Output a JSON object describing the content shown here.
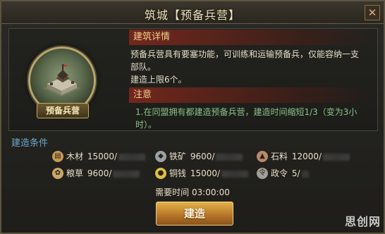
{
  "window": {
    "title": "筑城【预备兵营】",
    "close_label": "✕"
  },
  "building": {
    "name": "预备兵营"
  },
  "details": {
    "heading": "建筑详情",
    "line1": "预备兵营具有要塞功能，可训练和运输预备兵，仅能容纳一支",
    "line2": "部队。",
    "line3": "建造上限6个。"
  },
  "notes": {
    "heading": "注意",
    "line1": "1.在同盟拥有都建造预备兵营，建造时间缩短1/3（变为3小",
    "line2": "时）。"
  },
  "conditions": {
    "title": "建造条件",
    "resources": [
      {
        "icon": "wood-icon",
        "name": "木材",
        "value": "15000/",
        "color": "#c79a55"
      },
      {
        "icon": "iron-icon",
        "name": "铁矿",
        "value": "9600/",
        "color": "#9aa0a6"
      },
      {
        "icon": "stone-icon",
        "name": "石料",
        "value": "12000/",
        "color": "#b88a6a"
      },
      {
        "icon": "grain-icon",
        "name": "粮草",
        "value": "9600/",
        "color": "#c9a86a"
      },
      {
        "icon": "coin-icon",
        "name": "铜钱",
        "value": "15000/",
        "color": "#e0c040"
      },
      {
        "icon": "order-icon",
        "name": "政令",
        "value": "5/",
        "color": "#a0a098"
      }
    ]
  },
  "time": {
    "label": "需要时间",
    "value": "03:00:00"
  },
  "build_button": {
    "label": "建造"
  },
  "watermark": "思创网"
}
